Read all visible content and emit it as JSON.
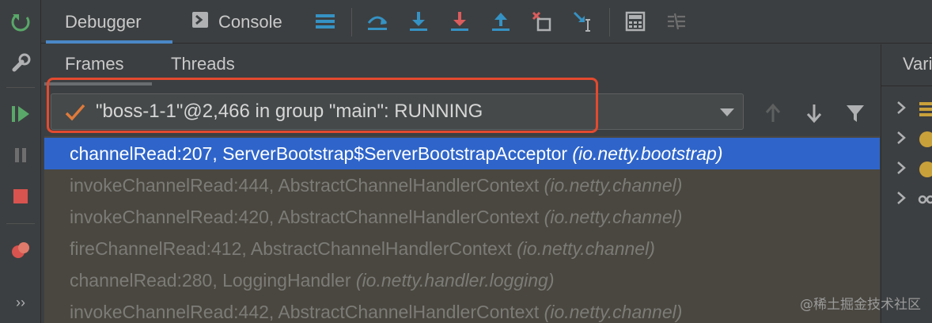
{
  "toolbar": {
    "tabs": [
      {
        "label": "Debugger",
        "active": true
      },
      {
        "label": "Console",
        "active": false
      }
    ],
    "icons": [
      "layout-lines-icon",
      "show-execution-point-icon",
      "step-over-icon",
      "step-into-icon",
      "force-step-into-icon",
      "step-out-icon",
      "drop-frame-icon",
      "run-to-cursor-icon",
      "evaluate-expression-icon",
      "trace-current-stream-icon"
    ]
  },
  "left_toolbar": {
    "icons": [
      "rerun-icon",
      "settings-wrench-icon",
      "resume-program-icon",
      "pause-program-icon",
      "stop-icon",
      "view-breakpoints-icon",
      "more-icon"
    ]
  },
  "frames_panel": {
    "subtabs": [
      {
        "label": "Frames",
        "active": true
      },
      {
        "label": "Threads",
        "active": false
      }
    ],
    "thread_selector": {
      "value": "\"boss-1-1\"@2,466 in group \"main\": RUNNING"
    },
    "frames": [
      {
        "method": "channelRead:207, ServerBootstrap$ServerBootstrapAcceptor",
        "package": "(io.netty.bootstrap)",
        "selected": true
      },
      {
        "method": "invokeChannelRead:444, AbstractChannelHandlerContext",
        "package": "(io.netty.channel)",
        "selected": false
      },
      {
        "method": "invokeChannelRead:420, AbstractChannelHandlerContext",
        "package": "(io.netty.channel)",
        "selected": false
      },
      {
        "method": "fireChannelRead:412, AbstractChannelHandlerContext",
        "package": "(io.netty.channel)",
        "selected": false
      },
      {
        "method": "channelRead:280, LoggingHandler",
        "package": "(io.netty.handler.logging)",
        "selected": false
      },
      {
        "method": "invokeChannelRead:442, AbstractChannelHandlerContext",
        "package": "(io.netty.channel)",
        "selected": false
      }
    ]
  },
  "variables_panel": {
    "title": "Variables"
  },
  "watermark": "@稀土掘金技术社区",
  "colors": {
    "selection": "#2f65ca",
    "highlight_box": "#e34a2f",
    "active_tab_underline": "#4a88c7",
    "frames_background": "#4a4740"
  }
}
